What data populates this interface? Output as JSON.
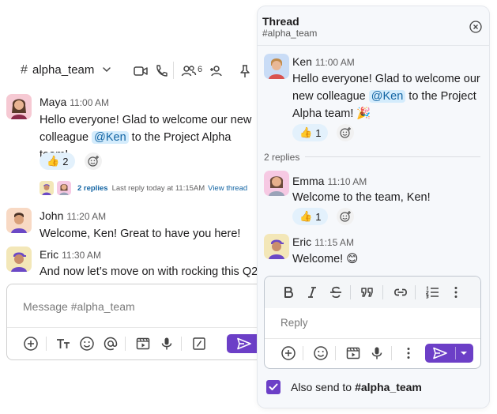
{
  "channel": {
    "hash": "#",
    "name": "alpha_team",
    "member_count": "6"
  },
  "messages": [
    {
      "author": "Maya",
      "time": "11:00 AM",
      "text_before": "Hello everyone! Glad to welcome our new colleague ",
      "mention": "@Ken",
      "text_after": " to the Project Alpha team!",
      "reaction_emoji": "👍",
      "reaction_count": "2"
    },
    {
      "author": "John",
      "time": "11:20 AM",
      "text": "Welcome, Ken! Great to have you here!"
    },
    {
      "author": "Eric",
      "time": "11:30 AM",
      "text": "And now let’s move on with rocking this Q2!"
    }
  ],
  "thread_summary": {
    "replies": "2 replies",
    "last_reply": "Last reply today at 11:15AM",
    "view_thread": "View thread"
  },
  "composer": {
    "placeholder": "Message #alpha_team"
  },
  "thread": {
    "title": "Thread",
    "channel": "#alpha_team",
    "parent": {
      "author": "Ken",
      "time": "11:00 AM",
      "text_before": "Hello everyone! Glad to welcome our new colleague ",
      "mention": "@Ken",
      "text_after": " to the Project Alpha team! 🎉",
      "reaction_emoji": "👍",
      "reaction_count": "1"
    },
    "replies_label": "2 replies",
    "replies": [
      {
        "author": "Emma",
        "time": "11:10 AM",
        "text": "Welcome to the team, Ken!",
        "reaction_emoji": "👍",
        "reaction_count": "1"
      },
      {
        "author": "Eric",
        "time": "11:15 AM",
        "text": "Welcome! 😊"
      }
    ],
    "reply_placeholder": "Reply",
    "also_send_label": "Also send to",
    "also_send_channel": "#alpha_team",
    "also_send_checked": true
  },
  "colors": {
    "accent": "#6c3fc7",
    "mention_bg": "#d4ecfc",
    "link": "#1264a3",
    "reaction_bg": "#e3f1fc"
  }
}
